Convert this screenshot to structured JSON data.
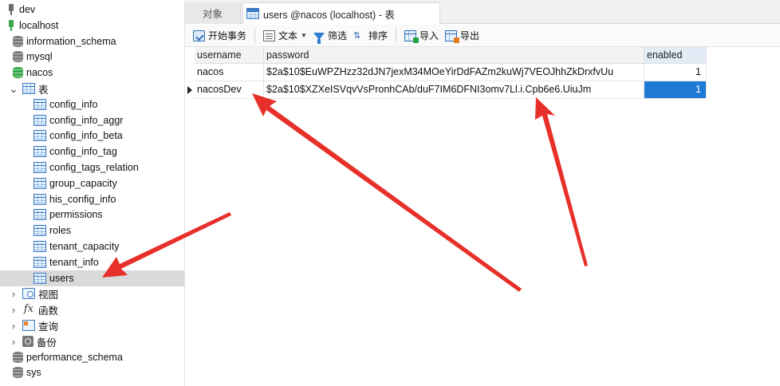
{
  "nav": {
    "items": [
      {
        "label": "dev",
        "icon": "connection-icon",
        "kind": "conn"
      },
      {
        "label": "localhost",
        "icon": "connection-icon",
        "kind": "conn-green"
      },
      {
        "label": "information_schema",
        "icon": "database-icon",
        "kind": "db"
      },
      {
        "label": "mysql",
        "icon": "database-icon",
        "kind": "db"
      },
      {
        "label": "nacos",
        "icon": "database-icon",
        "kind": "db-green"
      },
      {
        "label": "表",
        "icon": "table-icon",
        "kind": "folder-open"
      },
      {
        "label": "config_info",
        "icon": "table-icon",
        "kind": "table"
      },
      {
        "label": "config_info_aggr",
        "icon": "table-icon",
        "kind": "table"
      },
      {
        "label": "config_info_beta",
        "icon": "table-icon",
        "kind": "table"
      },
      {
        "label": "config_info_tag",
        "icon": "table-icon",
        "kind": "table"
      },
      {
        "label": "config_tags_relation",
        "icon": "table-icon",
        "kind": "table"
      },
      {
        "label": "group_capacity",
        "icon": "table-icon",
        "kind": "table"
      },
      {
        "label": "his_config_info",
        "icon": "table-icon",
        "kind": "table"
      },
      {
        "label": "permissions",
        "icon": "table-icon",
        "kind": "table"
      },
      {
        "label": "roles",
        "icon": "table-icon",
        "kind": "table"
      },
      {
        "label": "tenant_capacity",
        "icon": "table-icon",
        "kind": "table"
      },
      {
        "label": "tenant_info",
        "icon": "table-icon",
        "kind": "table"
      },
      {
        "label": "users",
        "icon": "table-icon",
        "kind": "table",
        "selected": true
      },
      {
        "label": "视图",
        "icon": "view-icon",
        "kind": "folder"
      },
      {
        "label": "函数",
        "icon": "function-icon",
        "kind": "folder"
      },
      {
        "label": "查询",
        "icon": "query-icon",
        "kind": "folder"
      },
      {
        "label": "备份",
        "icon": "backup-icon",
        "kind": "folder"
      },
      {
        "label": "performance_schema",
        "icon": "database-icon",
        "kind": "db"
      },
      {
        "label": "sys",
        "icon": "database-icon",
        "kind": "db"
      }
    ]
  },
  "tabs": {
    "objects_label": "对象",
    "active_label": "users @nacos (localhost) - 表"
  },
  "toolbar": {
    "begin_transaction": "开始事务",
    "text": "文本",
    "filter": "筛选",
    "sort": "排序",
    "import": "导入",
    "export": "导出"
  },
  "grid": {
    "columns": [
      "username",
      "password",
      "enabled"
    ],
    "rows": [
      {
        "username": "nacos",
        "password": "$2a$10$EuWPZHzz32dJN7jexM34MOeYirDdFAZm2kuWj7VEOJhhZkDrxfvUu",
        "enabled": "1"
      },
      {
        "username": "nacosDev",
        "password": "$2a$10$XZXeISVqvVsPronhCAb/duF7IM6DFNI3omv7Ll.i.Cpb6e6.UiuJm",
        "enabled": "1"
      }
    ],
    "current_row": 1
  },
  "colors": {
    "arrow": "#e8302a",
    "selection": "#1f7ad6",
    "tree_selected": "#d9d9d9"
  }
}
